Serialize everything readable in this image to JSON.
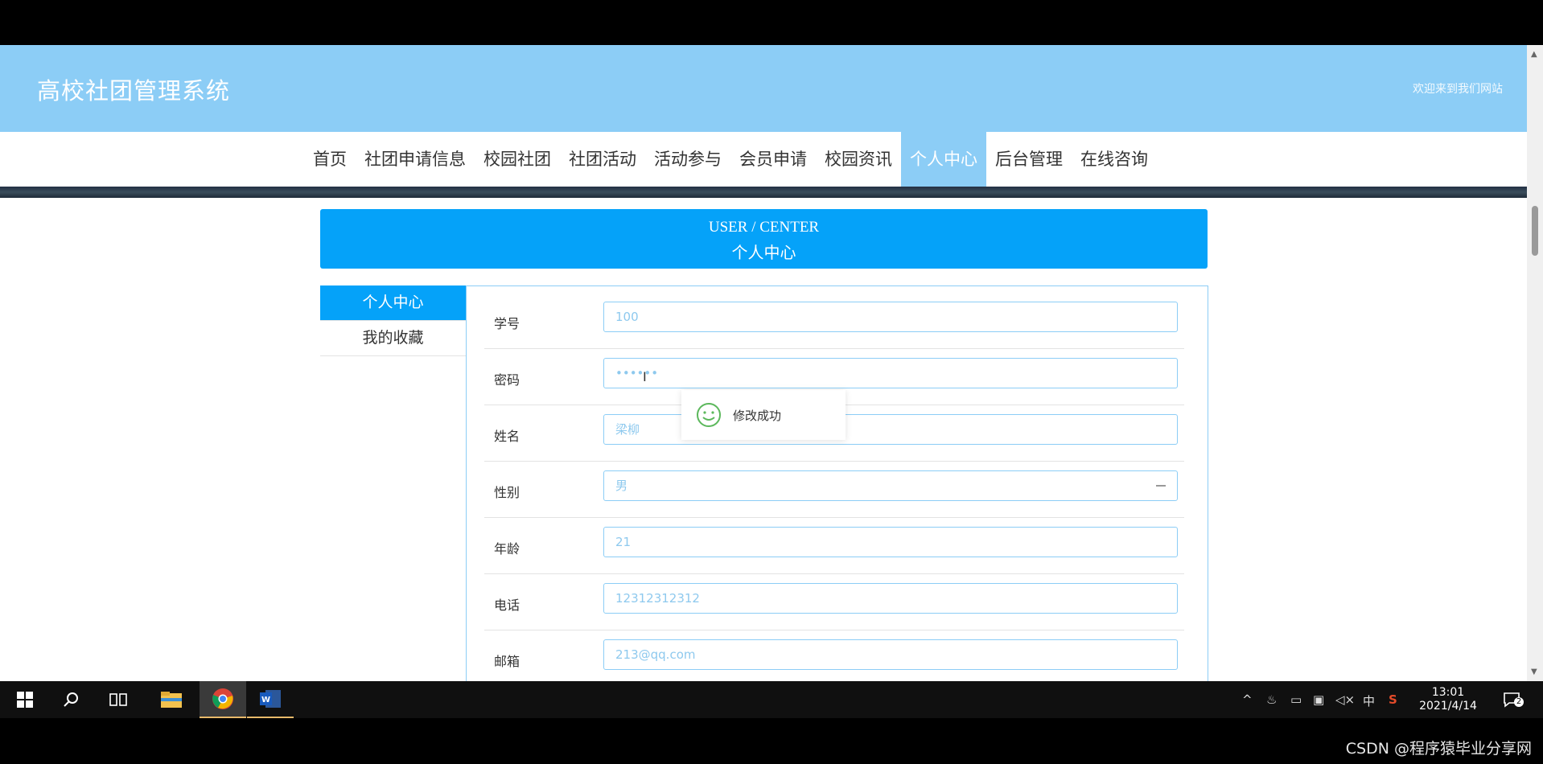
{
  "header": {
    "title": "高校社团管理系统",
    "welcome": "欢迎来到我们网站"
  },
  "nav": {
    "items": [
      {
        "label": "首页"
      },
      {
        "label": "社团申请信息"
      },
      {
        "label": "校园社团"
      },
      {
        "label": "社团活动"
      },
      {
        "label": "活动参与"
      },
      {
        "label": "会员申请"
      },
      {
        "label": "校园资讯"
      },
      {
        "label": "个人中心",
        "active": true
      },
      {
        "label": "后台管理"
      },
      {
        "label": "在线咨询"
      }
    ]
  },
  "banner": {
    "en": "USER / CENTER",
    "cn": "个人中心"
  },
  "sidemenu": {
    "items": [
      {
        "label": "个人中心",
        "active": true
      },
      {
        "label": "我的收藏"
      }
    ]
  },
  "form": {
    "fields": [
      {
        "label": "学号",
        "value": "100"
      },
      {
        "label": "密码",
        "value": "••••••"
      },
      {
        "label": "姓名",
        "value": "梁柳"
      },
      {
        "label": "性别",
        "value": "男"
      },
      {
        "label": "年龄",
        "value": "21"
      },
      {
        "label": "电话",
        "value": "12312312312"
      },
      {
        "label": "邮箱",
        "value": "213@qq.com"
      }
    ]
  },
  "toast": {
    "message": "修改成功",
    "icon": "smile-icon"
  },
  "taskbar": {
    "time": "13:01",
    "date": "2021/4/14",
    "ime": "中",
    "notification_count": "2",
    "apps": [
      "windows-start-icon",
      "search-icon",
      "task-view-icon",
      "file-explorer-icon",
      "chrome-icon",
      "word-icon"
    ]
  },
  "colors": {
    "header_bg": "#8ccdf6",
    "accent": "#05a2f9",
    "field_text": "#8ec9ee"
  },
  "watermark": "CSDN @程序猿毕业分享网"
}
